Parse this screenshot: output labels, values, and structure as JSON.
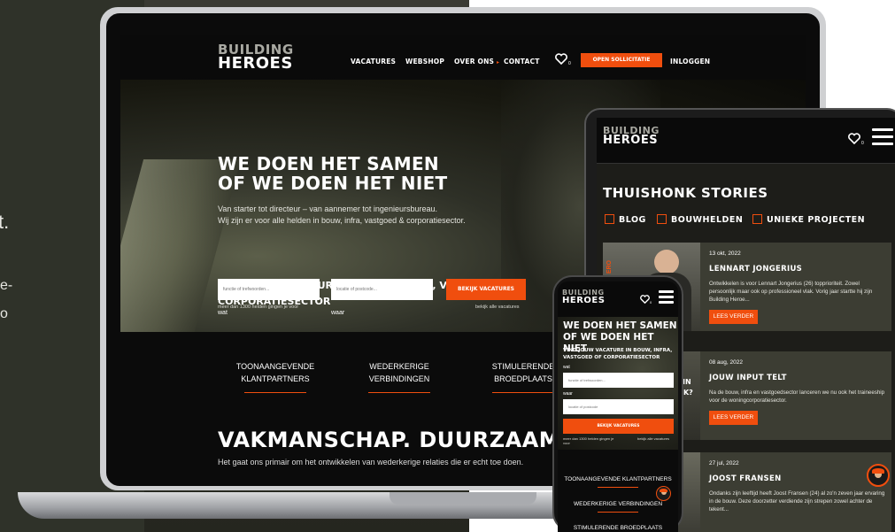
{
  "side_text": {
    "line1": "t.",
    "line2": "e-",
    "line3": "o"
  },
  "laptop": {
    "logo": {
      "line1": "BUILDING",
      "line2": "HEROES"
    },
    "nav": [
      "VACATURES",
      "WEBSHOP",
      "OVER ONS",
      "CONTACT"
    ],
    "nav_caret": "▸",
    "heart_count": "0",
    "apply_button": "OPEN SOLLICITATIE",
    "login": "INLOGGEN",
    "hero": {
      "title_line1": "WE DOEN HET SAMEN",
      "title_line2": "OF WE DOEN HET NIET",
      "subtitle_line1": "Van starter tot directeur – van aannemer tot ingenieursbureau.",
      "subtitle_line2": "Wij zijn er voor alle helden in bouw, infra, vastgoed & corporatiesector.",
      "search_title": "VIND JOUW VACATURE IN BOUW, INFRA, VASTGOED OF CORPORATIESECTOR",
      "label_wat": "wat",
      "label_waar": "waar",
      "wat_placeholder": "functie of trefwoorden...",
      "waar_placeholder": "locatie of postcode...",
      "search_button": "BEKIJK VACATURES",
      "note_left": "meer dan 1300 helden gingen je voor",
      "note_right": "bekijk alle vacatures"
    },
    "benefits": [
      {
        "line1": "TOONAANGEVENDE",
        "line2": "KLANTPARTNERS"
      },
      {
        "line1": "WEDERKERIGE",
        "line2": "VERBINDINGEN"
      },
      {
        "line1": "STIMULERENDE",
        "line2": "BROEDPLAATS"
      }
    ],
    "big_heading": "VAKMANSCHAP. DUURZAAM. SA",
    "big_sub": "Het gaat ons primair om het ontwikkelen van wederkerige relaties die er echt toe doen."
  },
  "tablet": {
    "logo": {
      "line1": "BUILDING",
      "line2": "HEROES"
    },
    "heart_count": "0",
    "title": "THUISHONK STORIES",
    "categories": [
      "BLOG",
      "BOUWHELDEN",
      "UNIEKE PROJECTEN"
    ],
    "cards": [
      {
        "date": "13 okt, 2022",
        "title": "LENNART JONGERIUS",
        "text": "Ontwikkelen is voor Lennart Jongerius (26) topprioriteit. Zowel persoonlijk maar ook op professioneel vlak. Vorig jaar startte hij zijn Building Heroe...",
        "button": "LEES VERDER"
      },
      {
        "date": "08 aug, 2022",
        "title": "JOUW INPUT TELT",
        "text": "Na de bouw, infra en vastgoedsector lanceren we nu ook het traineeship voor de woningcorporatiesector.",
        "button": "LEES VERDER"
      },
      {
        "date": "27 jul, 2022",
        "title": "JOOST FRANSEN",
        "text": "Ondanks zijn leeftijd heeft Joost Fransen (24) al zo'n zeven jaar ervaring in de bouw. Deze doorzetter verdiende zijn strepen zowel achter de tekent...",
        "button": ""
      }
    ],
    "side_frag_1": "ERO",
    "side_frag_2": "IN",
    "side_frag_3": "IJK?"
  },
  "phone": {
    "logo": {
      "line1": "BUILDING",
      "line2": "HEROES"
    },
    "heart_count": "0",
    "title_line1": "WE DOEN HET SAMEN",
    "title_line2": "OF WE DOEN HET NIET",
    "search_title": "VIND JOUW VACATURE IN BOUW, INFRA, VASTGOED OF CORPORATIESECTOR",
    "label_wat": "wat",
    "label_waar": "waar",
    "wat_placeholder": "functie of trefwoorden...",
    "waar_placeholder": "locatie of postcode",
    "search_button": "BEKIJK VACATURES",
    "note_left": "meer dan 1300 helden gingen je voor",
    "note_right": "bekijk alle vacatures",
    "items": [
      "TOONAANGEVENDE KLANTPARTNERS",
      "WEDERKERIGE VERBINDINGEN",
      "STIMULERENDE BROEDPLAATS"
    ]
  },
  "colors": {
    "accent": "#f04e0e",
    "dark": "#0b0b0b",
    "olive": "#3c3d33"
  }
}
